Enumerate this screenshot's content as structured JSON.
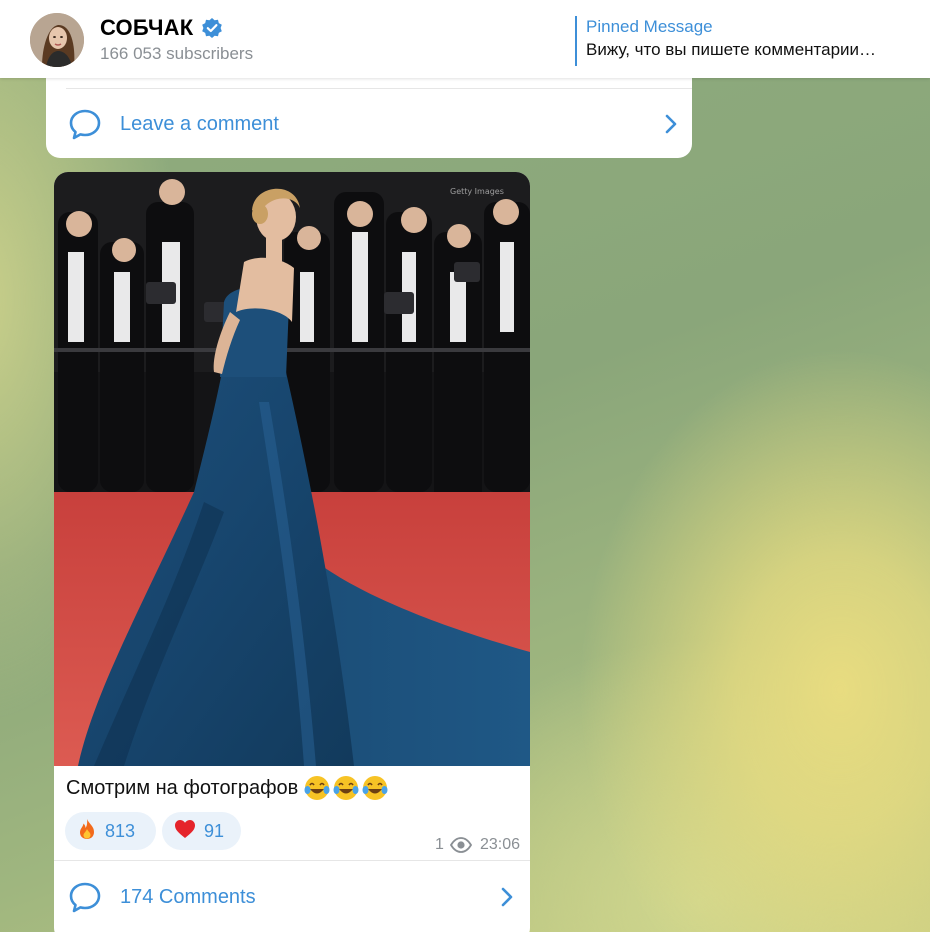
{
  "header": {
    "channel_name": "СОБЧАК",
    "verified_icon": "verified-badge-icon",
    "subscribers": "166 053 subscribers",
    "pinned_title": "Pinned Message",
    "pinned_text": "Вижу, что вы пишете комментарии…"
  },
  "previous_post": {
    "comment_label": "Leave a comment"
  },
  "post": {
    "photo_watermark": "Getty Images",
    "caption": "Смотрим на фотографов",
    "caption_emoji": [
      "face-with-tears-of-joy-icon",
      "face-with-tears-of-joy-icon",
      "face-with-tears-of-joy-icon"
    ],
    "reactions": [
      {
        "icon": "fire-icon",
        "count": "813"
      },
      {
        "icon": "heart-icon",
        "count": "91"
      }
    ],
    "views": "1",
    "time": "23:06",
    "comments_label": "174 Comments"
  },
  "colors": {
    "accent": "#3d8fd8",
    "reaction_bg": "#eaf2fa",
    "muted_text": "#8a8f94"
  }
}
